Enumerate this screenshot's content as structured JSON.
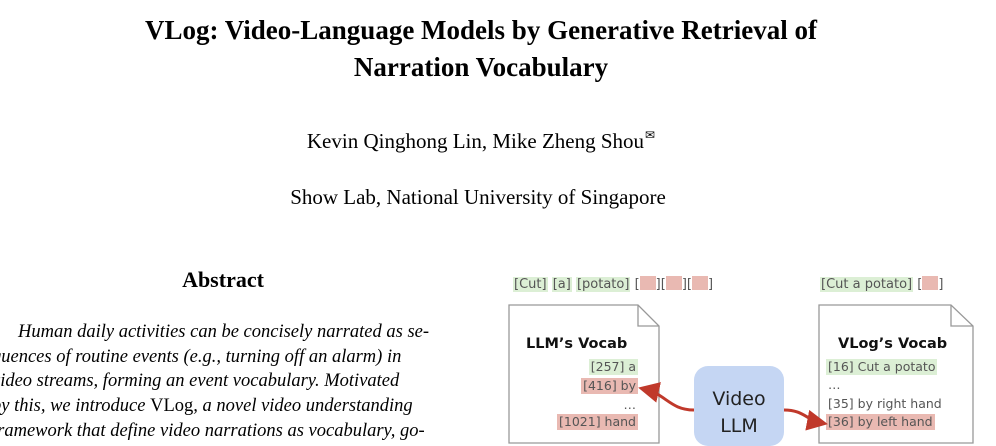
{
  "paper": {
    "title_line1": "VLog: Video-Language Models by Generative Retrieval of",
    "title_line2": "Narration Vocabulary",
    "authors": "Kevin Qinghong Lin, Mike Zheng Shou",
    "corresponding_mark": "✉",
    "affiliation": "Show Lab, National University of Singapore"
  },
  "abstract": {
    "heading": "Abstract",
    "line1": "Human daily activities can be concisely narrated as se-",
    "line2": "quences of routine events (e.g., turning off an alarm) in",
    "line3": "video streams, forming an event vocabulary.  Motivated",
    "line4_pre": "by this, we introduce ",
    "line4_name": "VLog",
    "line4_post": ", a novel video understanding",
    "line5": "framework that define video narrations as vocabulary, go-"
  },
  "figure": {
    "llm_tokens": [
      "[Cut]",
      "[a]",
      "[potato]"
    ],
    "vlog_tokens": [
      "[Cut a potato]"
    ],
    "llm_vocab": {
      "title": "LLM’s Vocab",
      "entries": [
        "[257] a",
        "[416] by",
        "…",
        "[1021] hand"
      ]
    },
    "vlog_vocab": {
      "title": "VLog’s Vocab",
      "entries": [
        "[16] Cut a potato",
        "…",
        "[35] by right hand",
        "[36] by left hand"
      ]
    },
    "model": {
      "line1": "Video",
      "line2": "LLM"
    },
    "colors": {
      "green": "#dcefd5",
      "red": "#e9b9b2",
      "blue": "#c5d6f3",
      "arrow": "#c0392b"
    }
  }
}
